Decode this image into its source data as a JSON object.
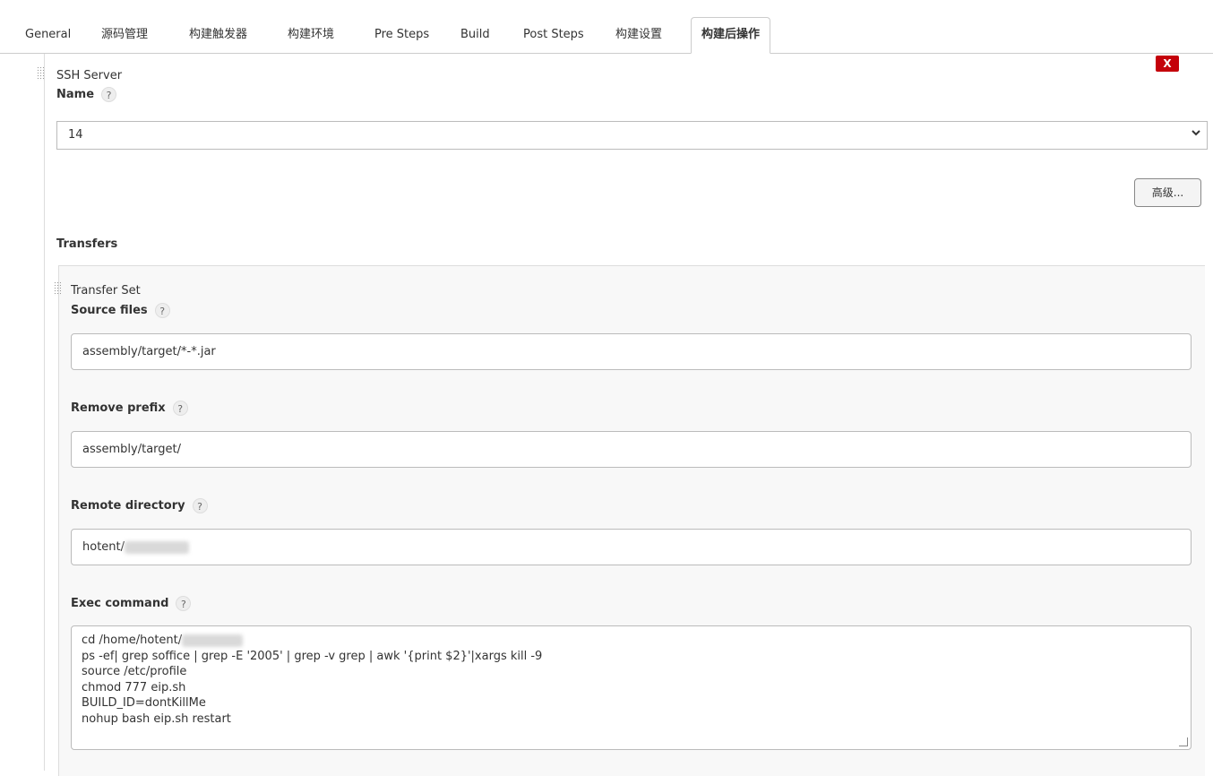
{
  "tabs": [
    {
      "label": "General"
    },
    {
      "label": "源码管理"
    },
    {
      "label": "构建触发器"
    },
    {
      "label": "构建环境"
    },
    {
      "label": "Pre Steps"
    },
    {
      "label": "Build"
    },
    {
      "label": "Post Steps"
    },
    {
      "label": "构建设置"
    },
    {
      "label": "构建后操作"
    }
  ],
  "ssh": {
    "section_title": "SSH Server",
    "name_label": "Name",
    "name_value": "14",
    "delete_label": "X",
    "advanced_label": "高级...",
    "transfers_label": "Transfers"
  },
  "transfer_set": {
    "title": "Transfer Set",
    "source_label": "Source files",
    "source_value": "assembly/target/*-*.jar",
    "prefix_label": "Remove prefix",
    "prefix_value": "assembly/target/",
    "remote_label": "Remote directory",
    "remote_value": "hotent/",
    "exec_label": "Exec command",
    "exec_lines": [
      "cd /home/hotent/",
      "ps -ef| grep soffice | grep -E '2005' | grep -v grep | awk '{print $2}'|xargs kill -9",
      "source /etc/profile",
      "chmod 777 eip.sh",
      "BUILD_ID=dontKillMe",
      "nohup bash eip.sh restart"
    ]
  },
  "help_glyph": "?",
  "colors": {
    "delete_bg": "#c4000a"
  }
}
